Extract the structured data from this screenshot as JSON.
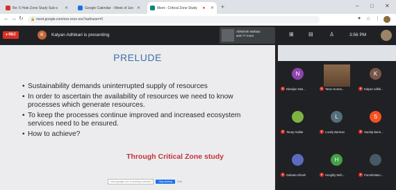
{
  "browser": {
    "tabs": [
      {
        "label": "Re: 5 Hole Zone Study Sub-s",
        "favicon_color": "#d93025",
        "active": false
      },
      {
        "label": "Google Calendar - Week of Jun",
        "favicon_color": "#1a73e8",
        "active": false
      },
      {
        "label": "Meet - Critical Zone Study",
        "favicon_color": "#00897b",
        "active": true
      }
    ],
    "new_tab_symbol": "+",
    "url": "meet.google.com/xxx-xxxx-xxx?authuser=0",
    "window_controls": [
      "–",
      "□",
      "✕"
    ]
  },
  "meet": {
    "rec_label": "● REC",
    "presenter_initial": "K",
    "presenter_text": "Kalyan Adhikari is presenting",
    "pinned": {
      "line1": "Abhishek Mahato",
      "line2": "and 77 more"
    },
    "clock": "3:56 PM"
  },
  "slide": {
    "title": "PRELUDE",
    "bullets": [
      "Sustainability demands uninterrupted supply of resources",
      "In order to ascertain the availability of resources we need to know processes which generate resources.",
      "To keep the processes continue improved and increased ecosystem services need to be ensured.",
      "How to achieve?"
    ],
    "answer": "Through Critical Zone study",
    "footer_share": "meet.google.com is sharing a window",
    "footer_hide": "Stop sharing",
    "footer_extra": "Hide"
  },
  "participants": [
    {
      "initial": "N",
      "name": "Niranjan Das...",
      "color": "#8e44ad"
    },
    {
      "initial": "",
      "name": "Tarun Kumar...",
      "color": "#6d4c41",
      "camera": true
    },
    {
      "initial": "K",
      "name": "Kalyan Adhik...",
      "color": "#795548"
    },
    {
      "initial": "",
      "name": "Tanay Haldar",
      "color": "#7cb342"
    },
    {
      "initial": "L",
      "name": "Lovely Barman",
      "color": "#546e7a"
    },
    {
      "initial": "S",
      "name": "Sandip Barm...",
      "color": "#f4511e"
    },
    {
      "initial": "",
      "name": "Subrata Ghosh",
      "color": "#5c6bc0"
    },
    {
      "initial": "H",
      "name": "Hooghly Moh...",
      "color": "#43a047"
    },
    {
      "initial": "",
      "name": "Purushottam...",
      "color": "#455a64"
    }
  ]
}
